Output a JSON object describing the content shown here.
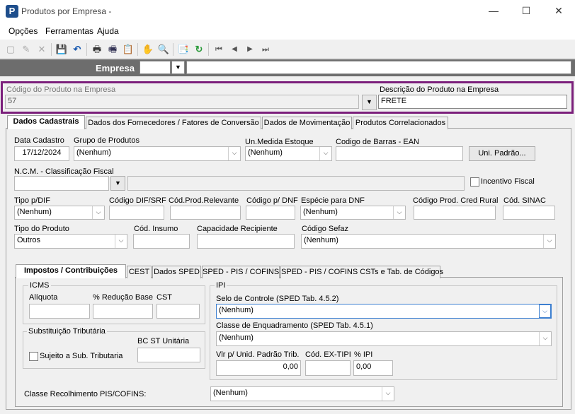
{
  "window": {
    "title": "Produtos por Empresa -",
    "app_icon_letter": "P",
    "minimize": "—",
    "maximize": "☐",
    "close": "✕"
  },
  "menu": [
    "Opções",
    "Ferramentas",
    "Ajuda"
  ],
  "toolbar_icons": [
    "new-icon",
    "edit-icon",
    "delete-icon",
    "save-icon",
    "undo-icon",
    "print-icon",
    "print-preview-icon",
    "export-icon",
    "hand-icon",
    "search-icon",
    "properties-icon",
    "refresh-icon",
    "first-icon",
    "prev-icon",
    "next-icon",
    "last-icon"
  ],
  "toolbar_glyphs": [
    "▢",
    "✎",
    "✕",
    "💾",
    "↶",
    "🖶",
    "🖷",
    "📋",
    "✋",
    "🔍",
    "📑",
    "↻",
    "⏮",
    "◀",
    "▶",
    "⏭"
  ],
  "empresa": {
    "label": "Empresa",
    "code": "",
    "name": ""
  },
  "produto": {
    "codigo_label": "Código do Produto na Empresa",
    "codigo_value": "57",
    "descricao_label": "Descrição do Produto na Empresa",
    "descricao_value": "FRETE"
  },
  "tabs": [
    "Dados Cadastrais",
    "Dados dos Fornecedores / Fatores de Conversão",
    "Dados de Movimentação",
    "Produtos Correlacionados"
  ],
  "cadastro": {
    "data_cadastro_label": "Data Cadastro",
    "data_cadastro": "17/12/2024",
    "grupo_label": "Grupo de Produtos",
    "grupo_value": "(Nenhum)",
    "unidade_label": "Un.Medida Estoque",
    "unidade_value": "(Nenhum)",
    "barras_label": "Codigo de Barras - EAN",
    "barras_value": "",
    "uni_padrao_btn": "Uni. Padrão...",
    "ncm_label": "N.C.M. -  Classificação Fiscal",
    "ncm_value": "",
    "ncm_desc": "",
    "incentivo_label": "Incentivo Fiscal",
    "tipo_dif_label": "Tipo p/DIF",
    "tipo_dif_value": "(Nenhum)",
    "codigo_dif_label": "Código DIF/SRF",
    "cod_prod_rel_label": "Cód.Prod.Relevante",
    "codigo_dnf_label": "Código p/ DNF",
    "especie_dnf_label": "Espécie para DNF",
    "especie_dnf_value": "(Nenhum)",
    "cred_rural_label": "Código Prod. Cred Rural",
    "sinac_label": "Cód. SINAC",
    "tipo_produto_label": "Tipo do Produto",
    "tipo_produto_value": "Outros",
    "insumo_label": "Cód. Insumo",
    "capacidade_label": "Capacidade Recipiente",
    "sefaz_label": "Código Sefaz",
    "sefaz_value": "(Nenhum)"
  },
  "subtabs": [
    "Impostos / Contribuições",
    "CEST",
    "Dados SPED",
    "SPED - PIS / COFINS",
    "SPED - PIS / COFINS CSTs e Tab. de Códigos"
  ],
  "icms": {
    "group_label": "ICMS",
    "aliquota_label": "Alíquota",
    "reducao_label": "% Redução Base",
    "cst_label": "CST",
    "st_group_label": "Substituição Tributária",
    "st_checkbox_label": "Sujeito a Sub. Tributaria",
    "bc_st_label": "BC ST Unitária"
  },
  "ipi": {
    "group_label": "IPI",
    "selo_label": "Selo de Controle (SPED Tab. 4.5.2)",
    "selo_value": "(Nenhum)",
    "enquadramento_label": "Classe de Enquadramento (SPED Tab. 4.5.1)",
    "enquadramento_value": "(Nenhum)",
    "vlr_label": "Vlr p/ Unid. Padrão Trib.",
    "vlr_value": "0,00",
    "ex_tipi_label": "Cód. EX-TIPI",
    "ex_tipi_value": "",
    "pct_label": "% IPI",
    "pct_value": "0,00"
  },
  "classe_pis": {
    "label": "Classe Recolhimento PIS/COFINS:",
    "value": "(Nenhum)"
  }
}
